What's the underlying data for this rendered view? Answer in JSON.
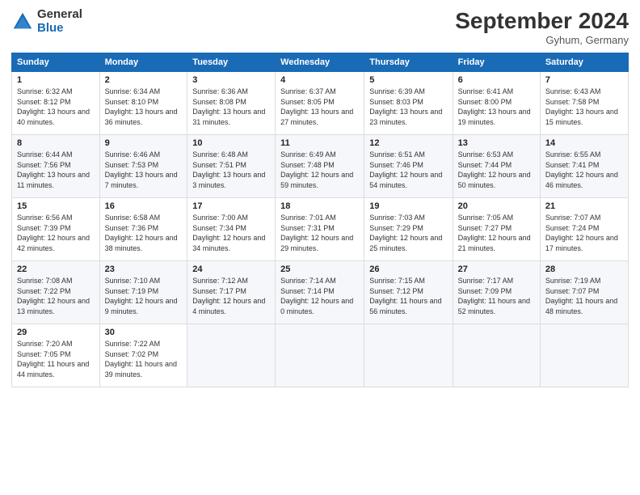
{
  "header": {
    "logo_general": "General",
    "logo_blue": "Blue",
    "month_title": "September 2024",
    "location": "Gyhum, Germany"
  },
  "weekdays": [
    "Sunday",
    "Monday",
    "Tuesday",
    "Wednesday",
    "Thursday",
    "Friday",
    "Saturday"
  ],
  "weeks": [
    [
      {
        "day": "1",
        "sunrise": "Sunrise: 6:32 AM",
        "sunset": "Sunset: 8:12 PM",
        "daylight": "Daylight: 13 hours and 40 minutes."
      },
      {
        "day": "2",
        "sunrise": "Sunrise: 6:34 AM",
        "sunset": "Sunset: 8:10 PM",
        "daylight": "Daylight: 13 hours and 36 minutes."
      },
      {
        "day": "3",
        "sunrise": "Sunrise: 6:36 AM",
        "sunset": "Sunset: 8:08 PM",
        "daylight": "Daylight: 13 hours and 31 minutes."
      },
      {
        "day": "4",
        "sunrise": "Sunrise: 6:37 AM",
        "sunset": "Sunset: 8:05 PM",
        "daylight": "Daylight: 13 hours and 27 minutes."
      },
      {
        "day": "5",
        "sunrise": "Sunrise: 6:39 AM",
        "sunset": "Sunset: 8:03 PM",
        "daylight": "Daylight: 13 hours and 23 minutes."
      },
      {
        "day": "6",
        "sunrise": "Sunrise: 6:41 AM",
        "sunset": "Sunset: 8:00 PM",
        "daylight": "Daylight: 13 hours and 19 minutes."
      },
      {
        "day": "7",
        "sunrise": "Sunrise: 6:43 AM",
        "sunset": "Sunset: 7:58 PM",
        "daylight": "Daylight: 13 hours and 15 minutes."
      }
    ],
    [
      {
        "day": "8",
        "sunrise": "Sunrise: 6:44 AM",
        "sunset": "Sunset: 7:56 PM",
        "daylight": "Daylight: 13 hours and 11 minutes."
      },
      {
        "day": "9",
        "sunrise": "Sunrise: 6:46 AM",
        "sunset": "Sunset: 7:53 PM",
        "daylight": "Daylight: 13 hours and 7 minutes."
      },
      {
        "day": "10",
        "sunrise": "Sunrise: 6:48 AM",
        "sunset": "Sunset: 7:51 PM",
        "daylight": "Daylight: 13 hours and 3 minutes."
      },
      {
        "day": "11",
        "sunrise": "Sunrise: 6:49 AM",
        "sunset": "Sunset: 7:48 PM",
        "daylight": "Daylight: 12 hours and 59 minutes."
      },
      {
        "day": "12",
        "sunrise": "Sunrise: 6:51 AM",
        "sunset": "Sunset: 7:46 PM",
        "daylight": "Daylight: 12 hours and 54 minutes."
      },
      {
        "day": "13",
        "sunrise": "Sunrise: 6:53 AM",
        "sunset": "Sunset: 7:44 PM",
        "daylight": "Daylight: 12 hours and 50 minutes."
      },
      {
        "day": "14",
        "sunrise": "Sunrise: 6:55 AM",
        "sunset": "Sunset: 7:41 PM",
        "daylight": "Daylight: 12 hours and 46 minutes."
      }
    ],
    [
      {
        "day": "15",
        "sunrise": "Sunrise: 6:56 AM",
        "sunset": "Sunset: 7:39 PM",
        "daylight": "Daylight: 12 hours and 42 minutes."
      },
      {
        "day": "16",
        "sunrise": "Sunrise: 6:58 AM",
        "sunset": "Sunset: 7:36 PM",
        "daylight": "Daylight: 12 hours and 38 minutes."
      },
      {
        "day": "17",
        "sunrise": "Sunrise: 7:00 AM",
        "sunset": "Sunset: 7:34 PM",
        "daylight": "Daylight: 12 hours and 34 minutes."
      },
      {
        "day": "18",
        "sunrise": "Sunrise: 7:01 AM",
        "sunset": "Sunset: 7:31 PM",
        "daylight": "Daylight: 12 hours and 29 minutes."
      },
      {
        "day": "19",
        "sunrise": "Sunrise: 7:03 AM",
        "sunset": "Sunset: 7:29 PM",
        "daylight": "Daylight: 12 hours and 25 minutes."
      },
      {
        "day": "20",
        "sunrise": "Sunrise: 7:05 AM",
        "sunset": "Sunset: 7:27 PM",
        "daylight": "Daylight: 12 hours and 21 minutes."
      },
      {
        "day": "21",
        "sunrise": "Sunrise: 7:07 AM",
        "sunset": "Sunset: 7:24 PM",
        "daylight": "Daylight: 12 hours and 17 minutes."
      }
    ],
    [
      {
        "day": "22",
        "sunrise": "Sunrise: 7:08 AM",
        "sunset": "Sunset: 7:22 PM",
        "daylight": "Daylight: 12 hours and 13 minutes."
      },
      {
        "day": "23",
        "sunrise": "Sunrise: 7:10 AM",
        "sunset": "Sunset: 7:19 PM",
        "daylight": "Daylight: 12 hours and 9 minutes."
      },
      {
        "day": "24",
        "sunrise": "Sunrise: 7:12 AM",
        "sunset": "Sunset: 7:17 PM",
        "daylight": "Daylight: 12 hours and 4 minutes."
      },
      {
        "day": "25",
        "sunrise": "Sunrise: 7:14 AM",
        "sunset": "Sunset: 7:14 PM",
        "daylight": "Daylight: 12 hours and 0 minutes."
      },
      {
        "day": "26",
        "sunrise": "Sunrise: 7:15 AM",
        "sunset": "Sunset: 7:12 PM",
        "daylight": "Daylight: 11 hours and 56 minutes."
      },
      {
        "day": "27",
        "sunrise": "Sunrise: 7:17 AM",
        "sunset": "Sunset: 7:09 PM",
        "daylight": "Daylight: 11 hours and 52 minutes."
      },
      {
        "day": "28",
        "sunrise": "Sunrise: 7:19 AM",
        "sunset": "Sunset: 7:07 PM",
        "daylight": "Daylight: 11 hours and 48 minutes."
      }
    ],
    [
      {
        "day": "29",
        "sunrise": "Sunrise: 7:20 AM",
        "sunset": "Sunset: 7:05 PM",
        "daylight": "Daylight: 11 hours and 44 minutes."
      },
      {
        "day": "30",
        "sunrise": "Sunrise: 7:22 AM",
        "sunset": "Sunset: 7:02 PM",
        "daylight": "Daylight: 11 hours and 39 minutes."
      },
      null,
      null,
      null,
      null,
      null
    ]
  ]
}
